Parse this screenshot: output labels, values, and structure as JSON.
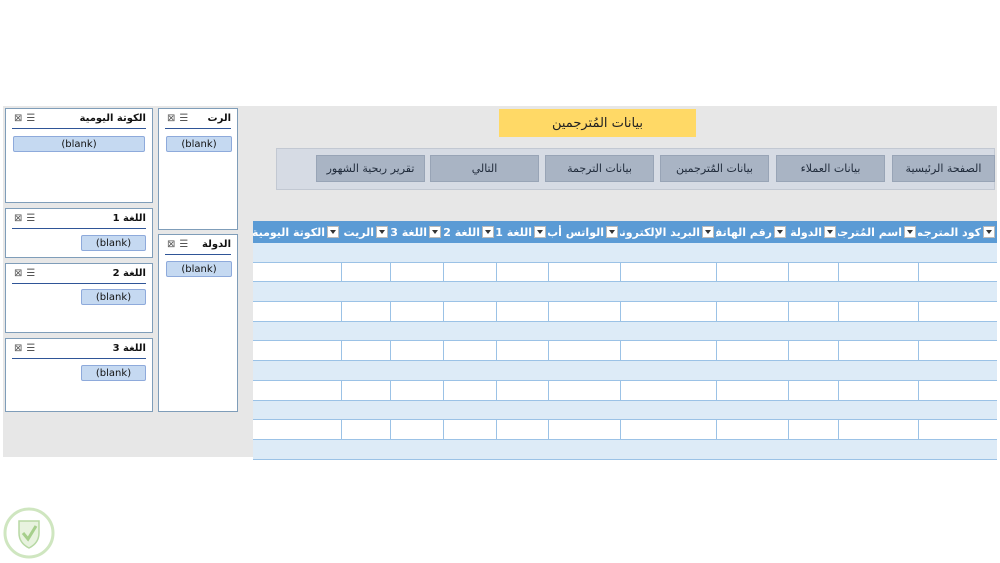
{
  "title": "بيانات المُترجمين",
  "nav": [
    {
      "id": "home",
      "label": "الصفحة الرئيسية"
    },
    {
      "id": "clients",
      "label": "بيانات العملاء"
    },
    {
      "id": "translators",
      "label": "بيانات المُترجمين"
    },
    {
      "id": "translation",
      "label": "بيانات الترجمة"
    },
    {
      "id": "next",
      "label": "التالي"
    },
    {
      "id": "profit",
      "label": "تقرير ربحية الشهور"
    }
  ],
  "slicers": {
    "daily_quota": {
      "title": "الكوتة اليومية",
      "item": "(blank)"
    },
    "language1": {
      "title": "اللغة 1",
      "item": "(blank)"
    },
    "language2": {
      "title": "اللغة 2",
      "item": "(blank)"
    },
    "language3": {
      "title": "اللغة 3",
      "item": "(blank)"
    },
    "rate": {
      "title": "الرت",
      "item": "(blank)"
    },
    "country": {
      "title": "الدولة",
      "item": "(blank)"
    }
  },
  "table": {
    "columns": [
      "كود المترجم",
      "اسم المُترجم",
      "الدولة",
      "رقم الهاتف",
      "البريد الإلكتروني",
      "الواتس أب",
      "اللغة 1",
      "اللغة 2",
      "اللغة 3",
      "الريت",
      "الكوتة اليومية"
    ]
  },
  "icons": {
    "filter": "clear-filter-icon",
    "multiselect": "multi-select-icon",
    "dropdown": "dropdown-arrow-icon",
    "logo": "shield-logo-icon"
  }
}
